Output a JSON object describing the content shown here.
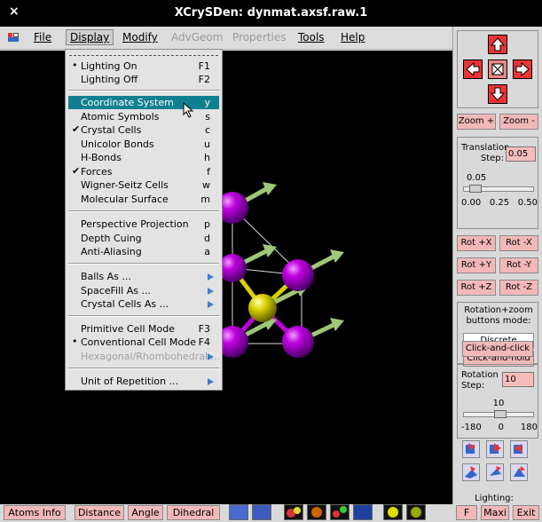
{
  "window": {
    "title": "XCrySDen: dynmat.axsf.raw.1",
    "close_glyph": "×"
  },
  "menubar": {
    "items": [
      {
        "label": "File",
        "state": "normal"
      },
      {
        "label": "Display",
        "state": "open"
      },
      {
        "label": "Modify",
        "state": "normal"
      },
      {
        "label": "AdvGeom",
        "state": "disabled"
      },
      {
        "label": "Properties",
        "state": "disabled"
      },
      {
        "label": "Tools",
        "state": "normal"
      },
      {
        "label": "Help",
        "state": "normal"
      }
    ]
  },
  "display_menu": {
    "items": [
      {
        "label": "Lighting On",
        "key": "F1",
        "mark": "•"
      },
      {
        "label": "Lighting Off",
        "key": "F2",
        "mark": ""
      },
      {
        "label": "Coordinate System",
        "key": "y",
        "mark": "",
        "highlighted": true
      },
      {
        "label": "Atomic Symbols",
        "key": "s",
        "mark": ""
      },
      {
        "label": "Crystal Cells",
        "key": "c",
        "mark": "✔"
      },
      {
        "label": "Unicolor Bonds",
        "key": "u",
        "mark": ""
      },
      {
        "label": "H-Bonds",
        "key": "h",
        "mark": ""
      },
      {
        "label": "Forces",
        "key": "f",
        "mark": "✔"
      },
      {
        "label": "Wigner-Seitz Cells",
        "key": "w",
        "mark": ""
      },
      {
        "label": "Molecular Surface",
        "key": "m",
        "mark": ""
      },
      {
        "label": "Perspective Projection",
        "key": "p",
        "mark": ""
      },
      {
        "label": "Depth Cuing",
        "key": "d",
        "mark": ""
      },
      {
        "label": "Anti-Aliasing",
        "key": "a",
        "mark": ""
      },
      {
        "label": "Balls As ...",
        "key": "",
        "mark": "",
        "submenu": true
      },
      {
        "label": "SpaceFill As ...",
        "key": "",
        "mark": "",
        "submenu": true
      },
      {
        "label": "Crystal Cells As ...",
        "key": "",
        "mark": "",
        "submenu": true
      },
      {
        "label": "Primitive Cell Mode",
        "key": "F3",
        "mark": ""
      },
      {
        "label": "Conventional Cell Mode",
        "key": "F4",
        "mark": "•"
      },
      {
        "label": "Hexagonal/Rhombohedral ...",
        "key": "",
        "mark": "",
        "submenu": true,
        "disabled": true
      },
      {
        "label": "Unit of Repetition ...",
        "key": "",
        "mark": "",
        "submenu": true
      }
    ]
  },
  "right_panel": {
    "zoom_plus": "Zoom +",
    "zoom_minus": "Zoom -",
    "translation_label": "Translation Step:",
    "translation_value": "0.05",
    "translation_readout": "0.05",
    "translation_ticks": [
      "0.00",
      "0.25",
      "0.50"
    ],
    "translation_level": 0.1,
    "rot_buttons": [
      "Rot +X",
      "Rot -X",
      "Rot +Y",
      "Rot -Y",
      "Rot +Z",
      "Rot -Z"
    ],
    "rotation_mode_label": "Rotation+zoom buttons mode:",
    "mode_discrete": "Discrete",
    "mode_hold": "Click-and-hold",
    "mode_click": "Click-and-click",
    "rotation_step_label": "Rotation Step:",
    "rotation_step_value": "10",
    "rotation_readout": "10",
    "rotation_ticks": [
      "-180",
      "0",
      "180"
    ],
    "rotation_level": 0.53,
    "lighting_label": "Lighting:"
  },
  "bottom_bar": {
    "buttons": [
      "Atoms Info",
      "Distance",
      "Angle",
      "Dihedral"
    ],
    "right_buttons": [
      "F",
      "Maxi",
      "Exit"
    ]
  },
  "colors": {
    "atom_magenta": "#b000d0",
    "atom_yellow": "#d8d000",
    "force_arrow": "#9ec878",
    "highlight": "#108090",
    "button_pink": "#f2b8b8"
  }
}
